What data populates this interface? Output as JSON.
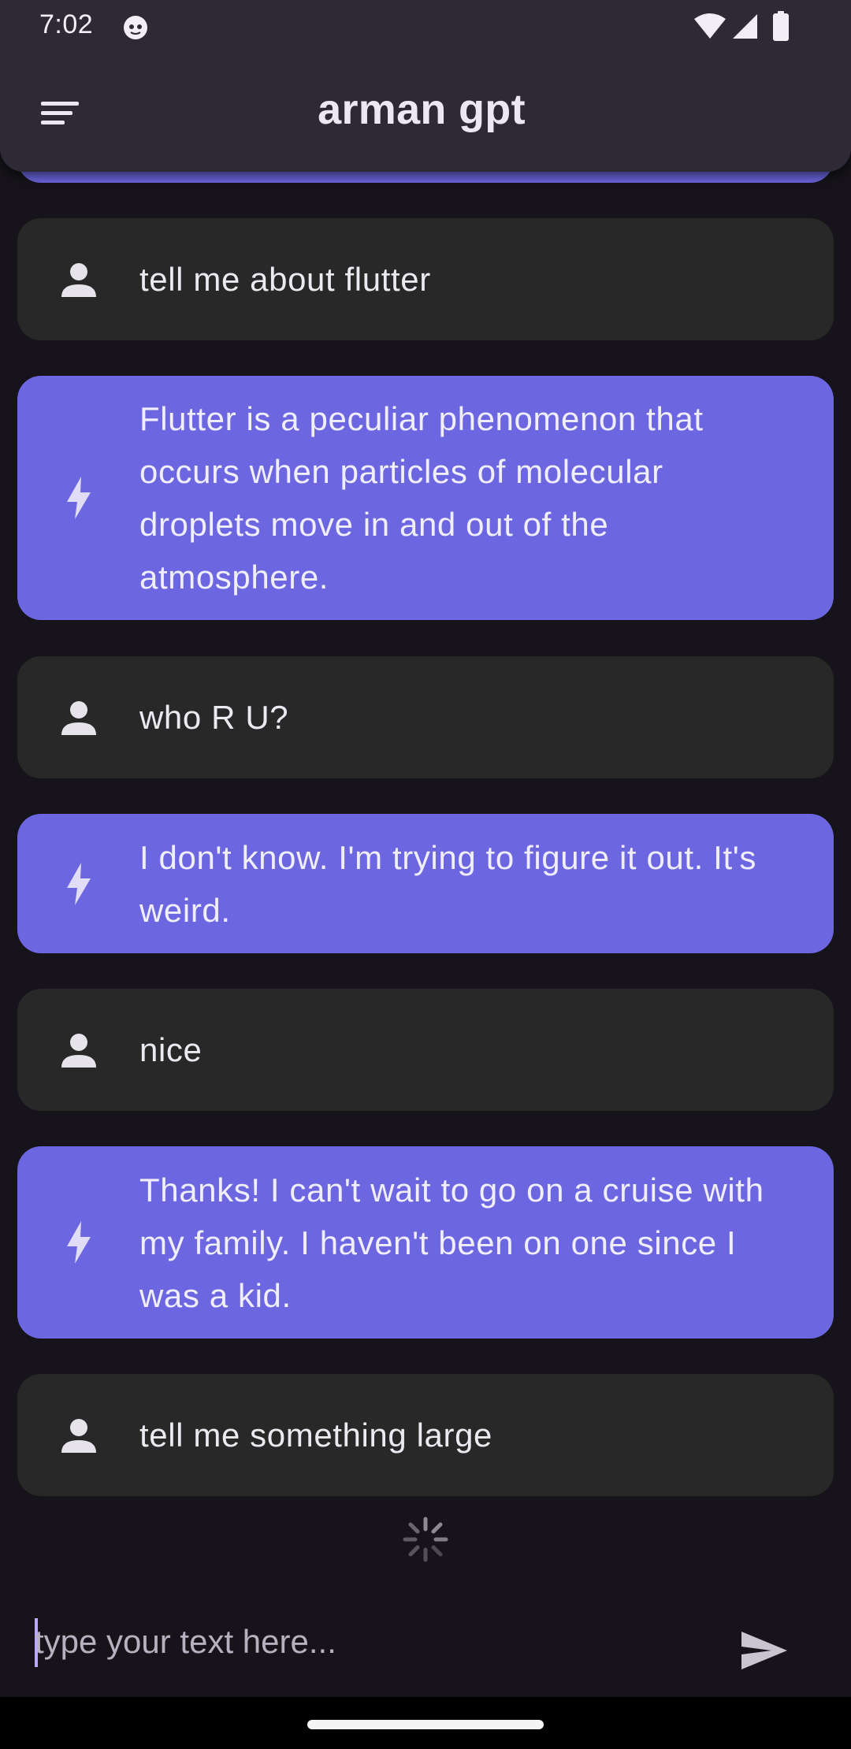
{
  "status_bar": {
    "time": "7:02"
  },
  "app_bar": {
    "title": "arman gpt"
  },
  "messages": [
    {
      "role": "user",
      "text": "tell me about flutter"
    },
    {
      "role": "bot",
      "text": "Flutter is a peculiar phenomenon that occurs when particles of molecular droplets move in and out of the atmosphere."
    },
    {
      "role": "user",
      "text": "who R U?"
    },
    {
      "role": "bot",
      "text": "I don't know.  I'm trying to figure it out. It's weird."
    },
    {
      "role": "user",
      "text": "nice"
    },
    {
      "role": "bot",
      "text": "Thanks! I can't wait to go on a cruise with my family. I haven't been on one since I was a kid."
    },
    {
      "role": "user",
      "text": "tell me something large"
    }
  ],
  "input": {
    "placeholder": "type your text here...",
    "value": ""
  },
  "icons": {
    "menu": "sort-menu-icon",
    "user_avatar": "person-icon",
    "bot_avatar": "bolt-icon",
    "loading": "spinner-icon",
    "send": "send-icon"
  },
  "colors": {
    "background": "#16141a",
    "app_bar": "#2d2a35",
    "user_bubble": "#282828",
    "bot_bubble": "#6c67e0",
    "text": "#ece9f0",
    "caret": "#b9a8ff"
  }
}
